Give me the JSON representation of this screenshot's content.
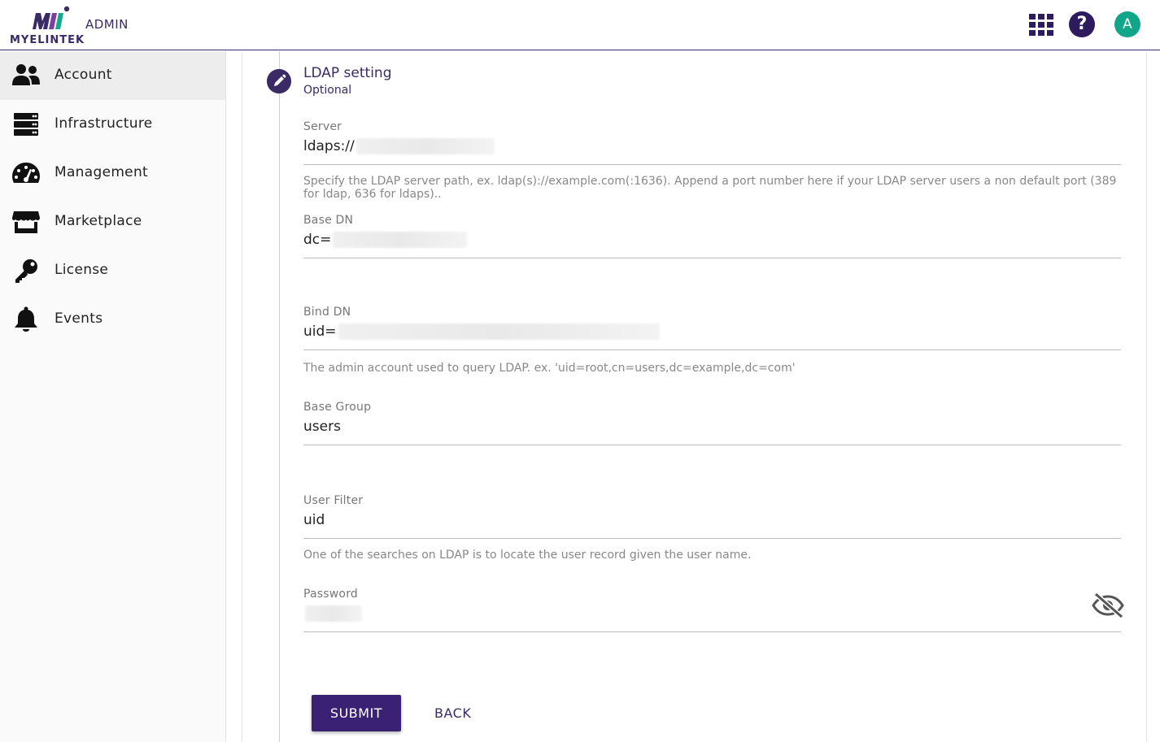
{
  "header": {
    "logo_text": "MYELINTEK",
    "admin_label": "ADMIN",
    "avatar_initial": "A",
    "help_glyph": "?"
  },
  "sidebar": {
    "items": [
      {
        "label": "Account",
        "icon": "users-icon",
        "active": true
      },
      {
        "label": "Infrastructure",
        "icon": "server-icon"
      },
      {
        "label": "Management",
        "icon": "gauge-icon"
      },
      {
        "label": "Marketplace",
        "icon": "store-icon"
      },
      {
        "label": "License",
        "icon": "key-icon"
      },
      {
        "label": "Events",
        "icon": "bell-icon"
      }
    ]
  },
  "step": {
    "title": "LDAP setting",
    "subtitle": "Optional"
  },
  "form": {
    "server": {
      "label": "Server",
      "value": "ldaps://",
      "helper": "Specify the LDAP server path, ex. ldap(s)://example.com(:1636). Append a port number here if your LDAP server users a non default port (389 for ldap, 636 for ldaps).."
    },
    "base_dn": {
      "label": "Base DN",
      "value": "dc="
    },
    "bind_dn": {
      "label": "Bind DN",
      "value": "uid=",
      "helper": "The admin account used to query LDAP. ex. 'uid=root,cn=users,dc=example,dc=com'"
    },
    "base_group": {
      "label": "Base Group",
      "value": "users"
    },
    "user_filter": {
      "label": "User Filter",
      "value": "uid",
      "helper": "One of the searches on LDAP is to locate the user record given the user name."
    },
    "password": {
      "label": "Password",
      "value": ""
    }
  },
  "actions": {
    "submit_label": "SUBMIT",
    "back_label": "BACK"
  },
  "colors": {
    "brand": "#3a2a66",
    "avatar": "#11a58a"
  }
}
